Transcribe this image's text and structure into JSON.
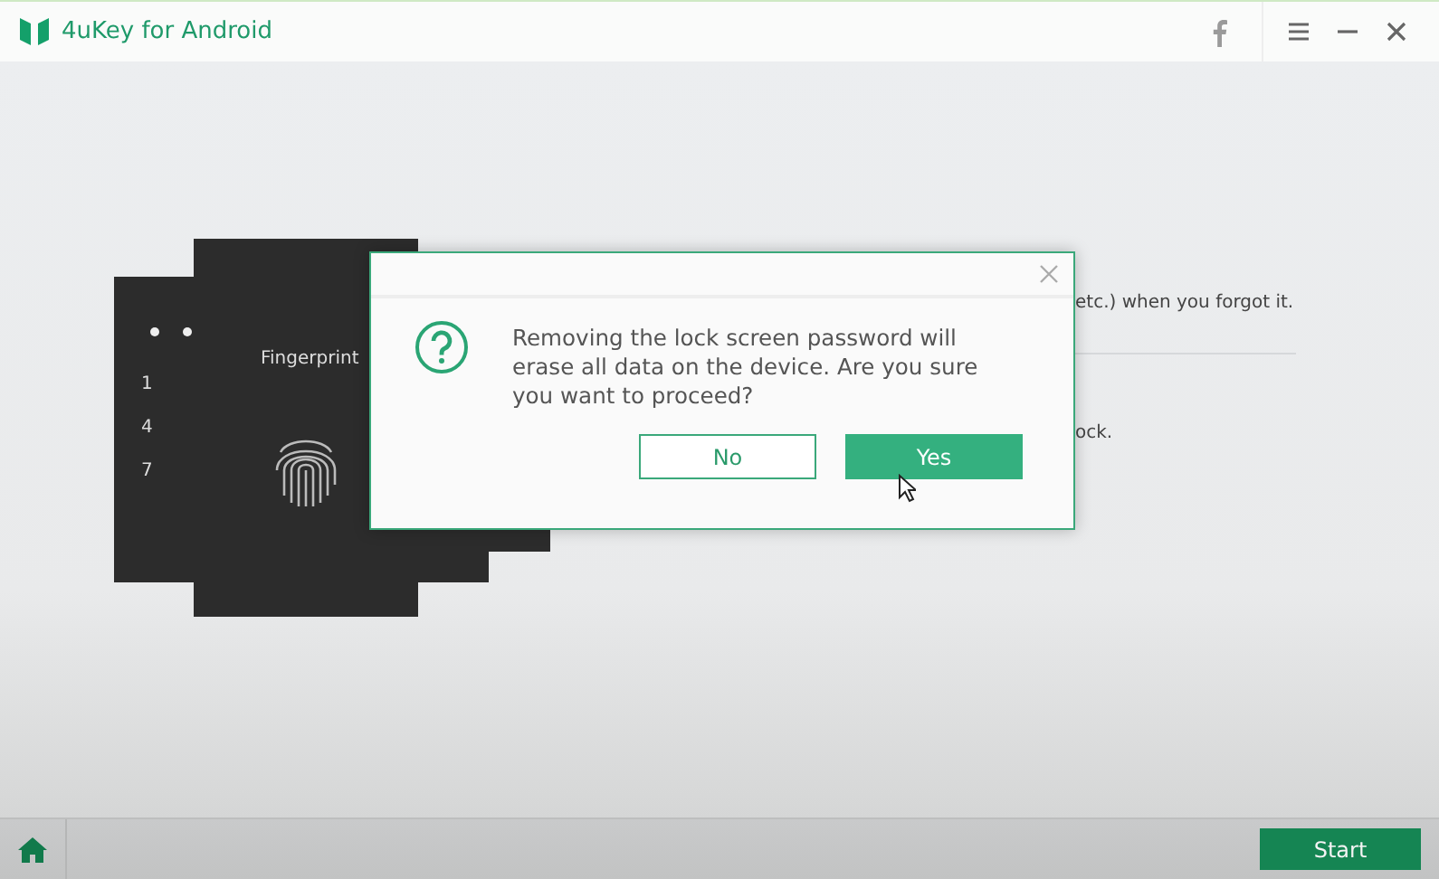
{
  "window": {
    "title": "4uKey for Android"
  },
  "background_text": [
    "etc.) when you forgot it.",
    "ock."
  ],
  "illustration": {
    "keypad_digits": [
      "1",
      "4",
      "7"
    ],
    "fingerprint_label": "Fingerprint"
  },
  "dialog": {
    "message": "Removing the lock screen password will erase all data on the device. Are you sure you want to proceed?",
    "buttons": [
      {
        "label": "No",
        "kind": "secondary"
      },
      {
        "label": "Yes",
        "kind": "primary"
      }
    ]
  },
  "footer": {
    "start_button": "Start"
  }
}
